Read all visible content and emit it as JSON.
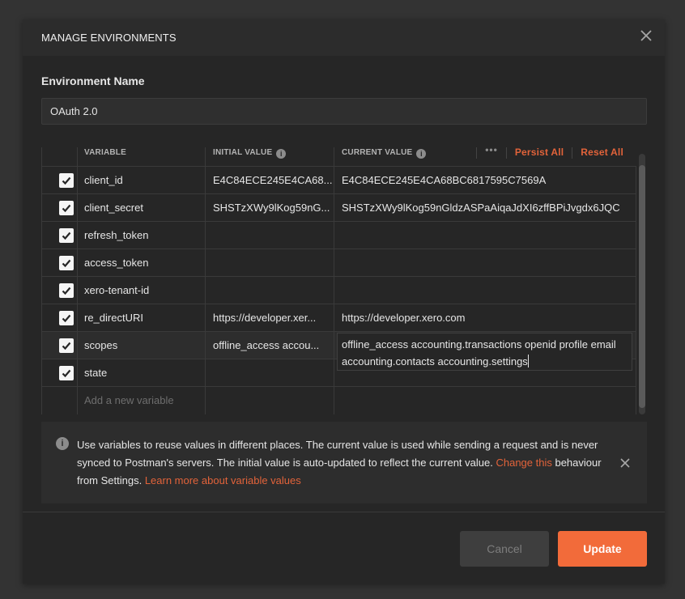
{
  "modal": {
    "title": "MANAGE ENVIRONMENTS",
    "close_icon": "close-icon"
  },
  "environment": {
    "label": "Environment Name",
    "value": "OAuth 2.0"
  },
  "table": {
    "headers": {
      "variable": "VARIABLE",
      "initial_value": "INITIAL VALUE",
      "current_value": "CURRENT VALUE",
      "info_glyph": "i",
      "more_glyph": "•••",
      "persist_all": "Persist All",
      "reset_all": "Reset All"
    },
    "rows": [
      {
        "checked": true,
        "variable": "client_id",
        "initial": "E4C84ECE245E4CA68...",
        "current": "E4C84ECE245E4CA68BC6817595C7569A"
      },
      {
        "checked": true,
        "variable": "client_secret",
        "initial": "SHSTzXWy9lKog59nG...",
        "current": "SHSTzXWy9lKog59nGldzASPaAiqaJdXI6zffBPiJvgdx6JQC"
      },
      {
        "checked": true,
        "variable": "refresh_token",
        "initial": "",
        "current": ""
      },
      {
        "checked": true,
        "variable": "access_token",
        "initial": "",
        "current": ""
      },
      {
        "checked": true,
        "variable": "xero-tenant-id",
        "initial": "",
        "current": ""
      },
      {
        "checked": true,
        "variable": "re_directURI",
        "initial": "https://developer.xer...",
        "current": "https://developer.xero.com"
      },
      {
        "checked": true,
        "variable": "scopes",
        "initial": "offline_access accou...",
        "current": "offline_access accounting.transactions openid profile email accounting.contacts accounting.settings"
      },
      {
        "checked": true,
        "variable": "state",
        "initial": "",
        "current": ""
      }
    ],
    "new_variable_placeholder": "Add a new variable"
  },
  "info": {
    "icon_glyph": "i",
    "text_1": "Use variables to reuse values in different places. The current value is used while sending a request and is never synced to Postman's servers. The initial value is auto-updated to reflect the current value. ",
    "link_1": "Change this",
    "text_2": " behaviour from Settings. ",
    "link_2": "Learn more about variable values"
  },
  "footer": {
    "cancel_label": "Cancel",
    "update_label": "Update"
  },
  "colors": {
    "accent": "#f26b3a",
    "link": "#e2633a",
    "background": "#262626"
  }
}
